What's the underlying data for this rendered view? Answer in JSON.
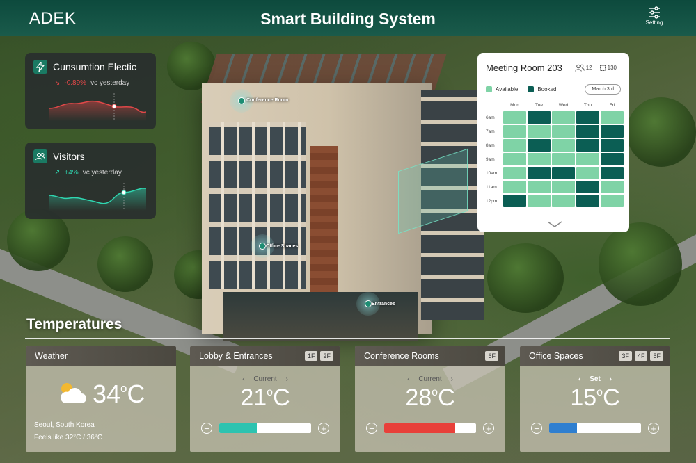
{
  "header": {
    "brand": "ADEK",
    "title": "Smart Building System",
    "settings_label": "Setting"
  },
  "metrics": {
    "consumption": {
      "title": "Cunsumtion Electic",
      "change": "-0.89%",
      "compare": "vc yesterday"
    },
    "visitors": {
      "title": "Visitors",
      "change": "+4%",
      "compare": "vc yesterday"
    }
  },
  "hotspots": {
    "conference": "Conference Room",
    "office": "Office Spaces",
    "entrances": "Entrances"
  },
  "meeting_room": {
    "title": "Meeting Room 203",
    "people": "12",
    "area": "130",
    "legend": {
      "available": "Available",
      "booked": "Booked"
    },
    "date": "March 3rd",
    "days": [
      "Mon",
      "Tue",
      "Wed",
      "Thu",
      "Fri"
    ],
    "times": [
      "6am",
      "7am",
      "8am",
      "9am",
      "10am",
      "11am",
      "12pm"
    ],
    "schedule": [
      [
        "a",
        "b",
        "a",
        "b",
        "a"
      ],
      [
        "a",
        "a",
        "a",
        "b",
        "b"
      ],
      [
        "a",
        "b",
        "a",
        "b",
        "b"
      ],
      [
        "a",
        "a",
        "a",
        "a",
        "b"
      ],
      [
        "a",
        "b",
        "b",
        "a",
        "b"
      ],
      [
        "a",
        "a",
        "a",
        "b",
        "a"
      ],
      [
        "b",
        "a",
        "a",
        "b",
        "a"
      ]
    ],
    "colors": {
      "available": "#7fd3a6",
      "booked": "#0b5e54"
    }
  },
  "temperatures": {
    "title": "Temperatures",
    "weather": {
      "title": "Weather",
      "temp": "34",
      "unit": "C",
      "location": "Seoul, South Korea",
      "feels_like": "Feels like  32°C / 36°C"
    },
    "lobby": {
      "title": "Lobby & Entrances",
      "floors": [
        "1F",
        "2F"
      ],
      "mode": "Current",
      "temp": "21",
      "unit": "C",
      "level": 0.41,
      "color": "#2dc3b0"
    },
    "conference": {
      "title": "Conference Rooms",
      "floors": [
        "6F"
      ],
      "mode": "Current",
      "temp": "28",
      "unit": "C",
      "level": 0.77,
      "color": "#e8403a"
    },
    "office": {
      "title": "Office Spaces",
      "floors": [
        "3F",
        "4F",
        "5F"
      ],
      "mode": "Set",
      "temp": "15",
      "unit": "C",
      "level": 0.3,
      "color": "#2f7fd0"
    }
  }
}
